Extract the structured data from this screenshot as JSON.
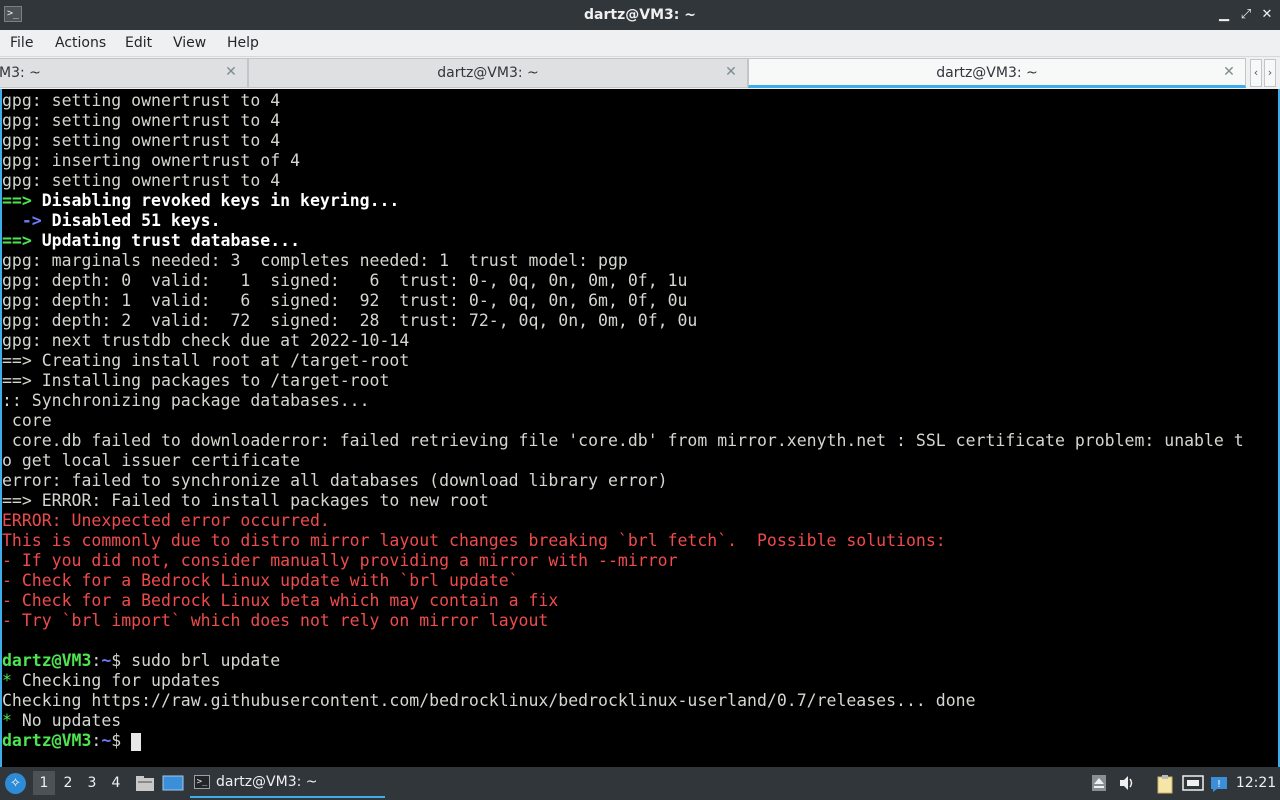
{
  "window": {
    "title": "dartz@VM3: ~",
    "minimize_glyph": "▁",
    "maximize_glyph": "⤢",
    "close_glyph": "✕",
    "app_icon_glyph": ">_"
  },
  "menu": {
    "items": [
      "File",
      "Actions",
      "Edit",
      "View",
      "Help"
    ]
  },
  "tabs": [
    {
      "label": "M3: ~",
      "close_glyph": "✕",
      "active": false
    },
    {
      "label": "dartz@VM3: ~",
      "close_glyph": "✕",
      "active": false
    },
    {
      "label": "dartz@VM3: ~",
      "close_glyph": "✕",
      "active": true
    }
  ],
  "tab_scroll": {
    "left_glyph": "‹",
    "right_glyph": "›"
  },
  "terminal": {
    "lines": [
      [
        {
          "t": "gpg: setting ownertrust to 4",
          "s": ""
        }
      ],
      [
        {
          "t": "gpg: setting ownertrust to 4",
          "s": ""
        }
      ],
      [
        {
          "t": "gpg: setting ownertrust to 4",
          "s": ""
        }
      ],
      [
        {
          "t": "gpg: inserting ownertrust of 4",
          "s": ""
        }
      ],
      [
        {
          "t": "gpg: setting ownertrust to 4",
          "s": ""
        }
      ],
      [
        {
          "t": "==> ",
          "s": "g"
        },
        {
          "t": "Disabling revoked keys in keyring...",
          "s": "b"
        }
      ],
      [
        {
          "t": "  -> ",
          "s": "bl"
        },
        {
          "t": "Disabled 51 keys.",
          "s": "b"
        }
      ],
      [
        {
          "t": "==> ",
          "s": "g"
        },
        {
          "t": "Updating trust database...",
          "s": "b"
        }
      ],
      [
        {
          "t": "gpg: marginals needed: 3  completes needed: 1  trust model: pgp",
          "s": ""
        }
      ],
      [
        {
          "t": "gpg: depth: 0  valid:   1  signed:   6  trust: 0-, 0q, 0n, 0m, 0f, 1u",
          "s": ""
        }
      ],
      [
        {
          "t": "gpg: depth: 1  valid:   6  signed:  92  trust: 0-, 0q, 0n, 6m, 0f, 0u",
          "s": ""
        }
      ],
      [
        {
          "t": "gpg: depth: 2  valid:  72  signed:  28  trust: 72-, 0q, 0n, 0m, 0f, 0u",
          "s": ""
        }
      ],
      [
        {
          "t": "gpg: next trustdb check due at 2022-10-14",
          "s": ""
        }
      ],
      [
        {
          "t": "==> Creating install root at /target-root",
          "s": ""
        }
      ],
      [
        {
          "t": "==> Installing packages to /target-root",
          "s": ""
        }
      ],
      [
        {
          "t": ":: Synchronizing package databases...",
          "s": ""
        }
      ],
      [
        {
          "t": " core",
          "s": ""
        }
      ],
      [
        {
          "t": " core.db failed to downloaderror: failed retrieving file 'core.db' from mirror.xenyth.net : SSL certificate problem: unable t",
          "s": ""
        }
      ],
      [
        {
          "t": "o get local issuer certificate",
          "s": ""
        }
      ],
      [
        {
          "t": "error: failed to synchronize all databases (download library error)",
          "s": ""
        }
      ],
      [
        {
          "t": "==> ERROR: Failed to install packages to new root",
          "s": ""
        }
      ],
      [
        {
          "t": "ERROR: Unexpected error occurred.",
          "s": "r"
        }
      ],
      [
        {
          "t": "This is commonly due to distro mirror layout changes breaking `brl fetch`.  Possible solutions:",
          "s": "r"
        }
      ],
      [
        {
          "t": "- If you did not, consider manually providing a mirror with --mirror",
          "s": "r"
        }
      ],
      [
        {
          "t": "- Check for a Bedrock Linux update with `brl update`",
          "s": "r"
        }
      ],
      [
        {
          "t": "- Check for a Bedrock Linux beta which may contain a fix",
          "s": "r"
        }
      ],
      [
        {
          "t": "- Try `brl import` which does not rely on mirror layout",
          "s": "r"
        }
      ],
      [
        {
          "t": "",
          "s": ""
        }
      ],
      [
        {
          "t": "dartz@VM3",
          "s": "g"
        },
        {
          "t": ":",
          "s": ""
        },
        {
          "t": "~",
          "s": "bl"
        },
        {
          "t": "$ sudo brl update",
          "s": ""
        }
      ],
      [
        {
          "t": "*",
          "s": "gn"
        },
        {
          "t": " Checking for updates",
          "s": ""
        }
      ],
      [
        {
          "t": "Checking https://raw.githubusercontent.com/bedrocklinux/bedrocklinux-userland/0.7/releases... done",
          "s": ""
        }
      ],
      [
        {
          "t": "*",
          "s": "gn"
        },
        {
          "t": " No updates",
          "s": ""
        }
      ],
      [
        {
          "t": "dartz@VM3",
          "s": "g"
        },
        {
          "t": ":",
          "s": ""
        },
        {
          "t": "~",
          "s": "bl"
        },
        {
          "t": "$ ",
          "s": ""
        }
      ]
    ]
  },
  "taskbar": {
    "desktops": [
      "1",
      "2",
      "3",
      "4"
    ],
    "active_desktop": "1",
    "task_label": "dartz@VM3: ~",
    "clock": "12:21",
    "tray_icons": [
      "eject-icon",
      "volume-icon",
      "clipboard-icon",
      "network-icon",
      "update-notifier-icon"
    ]
  },
  "colors": {
    "accent": "#3daee9",
    "prompt_green": "#4ee64e",
    "error_red": "#ef4b4b",
    "arrow_blue": "#6f7bff"
  }
}
